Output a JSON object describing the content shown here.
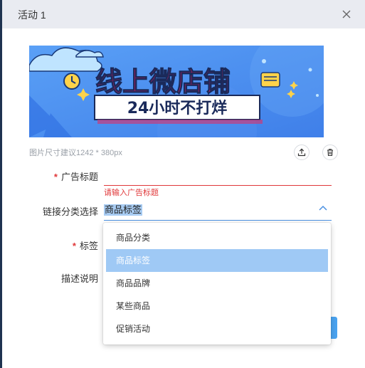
{
  "dialog": {
    "title": "活动 1",
    "close_icon": "close-icon"
  },
  "banner": {
    "headline": "线上微店铺",
    "subline": "24小时不打烊",
    "bg_color": "#4a8cf0"
  },
  "image_hint": "图片尺寸建议1242 * 380px",
  "icons": {
    "upload": "upload-icon",
    "delete": "trash-icon"
  },
  "form": {
    "ad_title_label": "广告标题",
    "ad_title_value": "",
    "ad_title_error": "请输入广告标题",
    "link_type_label": "链接分类选择",
    "link_type_value": "商品标签",
    "tag_label": "标签",
    "desc_label": "描述说明",
    "required_mark": "*"
  },
  "dropdown": {
    "options": [
      "商品分类",
      "商品标签",
      "商品品牌",
      "某些商品",
      "促销活动"
    ],
    "selected": "商品标签"
  },
  "colors": {
    "error": "#e0383a",
    "selected_option": "#9fc9f5",
    "header_bg": "#e9ebf1"
  }
}
